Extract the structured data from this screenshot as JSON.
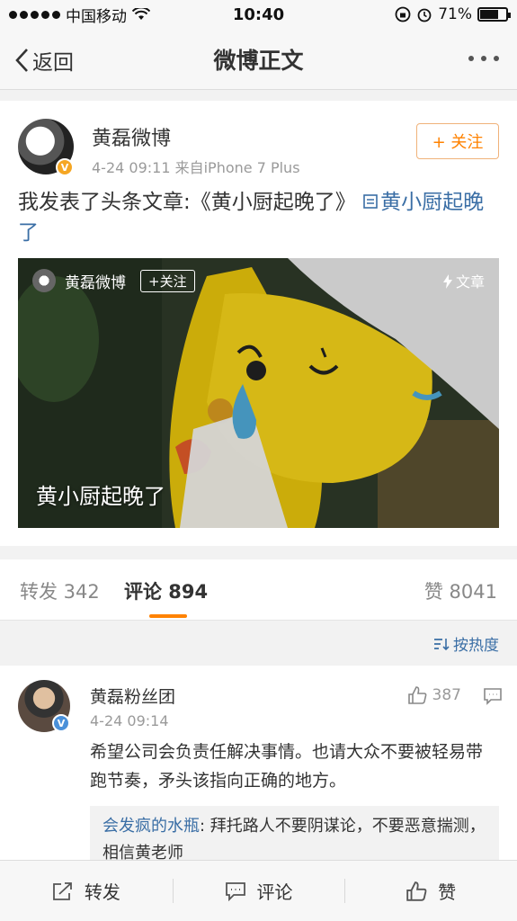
{
  "status_bar": {
    "carrier": "中国移动",
    "time": "10:40",
    "battery": "71%",
    "battery_level": 0.71
  },
  "nav": {
    "back_label": "返回",
    "title": "微博正文"
  },
  "post": {
    "author": "黄磊微博",
    "meta": "4-24 09:11  来自iPhone 7 Plus",
    "follow_label": "+ 关注",
    "text": "我发表了头条文章:《黄小厨起晚了》 ",
    "link_text": "黄小厨起晚了",
    "article": {
      "author": "黄磊微博",
      "follow_label": "+关注",
      "tag": "文章",
      "caption": "黄小厨起晚了"
    }
  },
  "tabs": {
    "repost": "转发 342",
    "comment": "评论 894",
    "like": "赞 8041"
  },
  "sort": {
    "label": "按热度"
  },
  "comment": {
    "author": "黄磊粉丝团",
    "time": "4-24 09:14",
    "likes": "387",
    "text": "希望公司会负责任解决事情。也请大众不要被轻易带跑节奏，矛头该指向正确的地方。",
    "reply_user": "会发疯的水瓶",
    "reply_text": ": 拜托路人不要阴谋论，不要恶意揣测，相信黄老师"
  },
  "toolbar": {
    "repost": "转发",
    "comment": "评论",
    "like": "赞"
  }
}
